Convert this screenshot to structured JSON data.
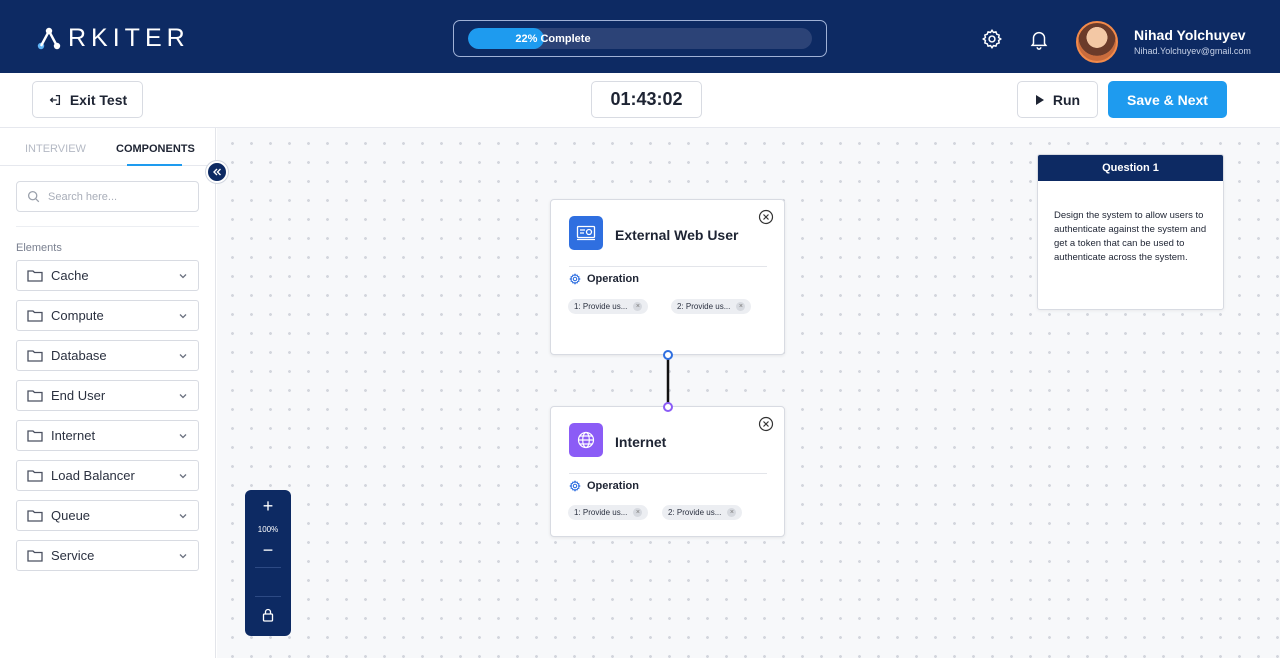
{
  "header": {
    "logo_text": "RKITER",
    "progress": {
      "label": "22% Complete",
      "percent": 22
    },
    "user": {
      "name": "Nihad Yolchuyev",
      "email": "Nihad.Yolchuyev@gmail.com"
    },
    "icons": [
      "settings-icon",
      "bell-icon"
    ]
  },
  "toolbar": {
    "exit_label": "Exit Test",
    "timer": "01:43:02",
    "run_label": "Run",
    "save_label": "Save & Next"
  },
  "sidebar": {
    "tabs": [
      {
        "label": "INTERVIEW",
        "active": false
      },
      {
        "label": "COMPONENTS",
        "active": true
      }
    ],
    "search_placeholder": "Search here...",
    "elements_label": "Elements",
    "elements": [
      {
        "label": "Cache"
      },
      {
        "label": "Compute"
      },
      {
        "label": "Database"
      },
      {
        "label": "End User"
      },
      {
        "label": "Internet"
      },
      {
        "label": "Load Balancer"
      },
      {
        "label": "Queue"
      },
      {
        "label": "Service"
      }
    ]
  },
  "canvas": {
    "nodes": [
      {
        "title": "External Web User",
        "icon": "web-user-icon",
        "icon_color": "#2f6fe0",
        "operation_label": "Operation",
        "chips": [
          "1: Provide us...",
          "2: Provide us..."
        ]
      },
      {
        "title": "Internet",
        "icon": "globe-icon",
        "icon_color": "#8b5cf6",
        "operation_label": "Operation",
        "chips": [
          "1: Provide us...",
          "2: Provide us..."
        ]
      }
    ],
    "question": {
      "title": "Question 1",
      "text": "Design the system to allow users to authenticate against the system and get a token that can be used to authenticate across the system."
    },
    "zoom": {
      "in": "+",
      "level": "100%",
      "out": "−"
    }
  },
  "colors": {
    "navy": "#0d2a63",
    "accent": "#1e9bef",
    "node_blue": "#2f6fe0",
    "node_purple": "#8b5cf6"
  }
}
